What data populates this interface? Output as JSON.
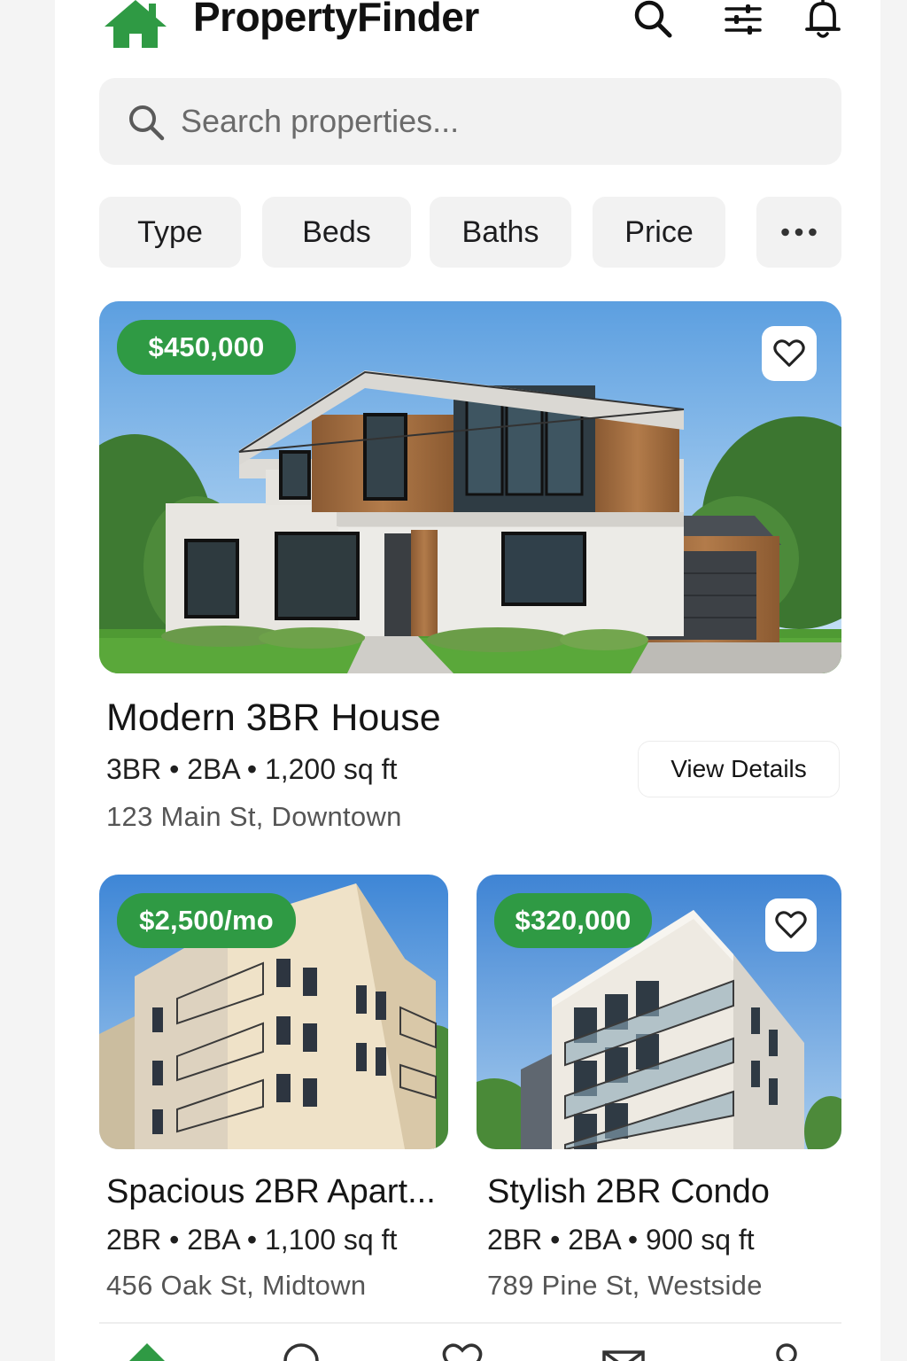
{
  "app": {
    "title": "PropertyFinder",
    "logo_icon": "house-icon",
    "accent_color": "#2f9a44"
  },
  "header": {
    "icons": [
      "search-icon",
      "sliders-icon",
      "bell-icon"
    ]
  },
  "search": {
    "placeholder": "Search properties...",
    "value": ""
  },
  "filters": {
    "chips": [
      "Type",
      "Beds",
      "Baths",
      "Price"
    ],
    "more_icon": "more-horizontal-icon"
  },
  "featured": {
    "price": "$450,000",
    "title": "Modern 3BR House",
    "specs": "3BR • 2BA • 1,200 sq ft",
    "address": "123 Main St, Downtown",
    "view_label": "View Details",
    "favorite_icon": "heart-icon"
  },
  "listings": [
    {
      "price": "$2,500/mo",
      "title": "Spacious 2BR Apart...",
      "specs": "2BR • 2BA • 1,100 sq ft",
      "address": "456 Oak St, Midtown"
    },
    {
      "price": "$320,000",
      "title": "Stylish 2BR Condo",
      "specs": "2BR • 2BA • 900 sq ft",
      "address": "789 Pine St, Westside",
      "favorite_icon": "heart-icon"
    }
  ],
  "bottom_nav": {
    "icons": [
      "home-icon",
      "search-icon",
      "heart-icon",
      "mail-icon",
      "profile-icon"
    ],
    "active": "home-icon"
  }
}
